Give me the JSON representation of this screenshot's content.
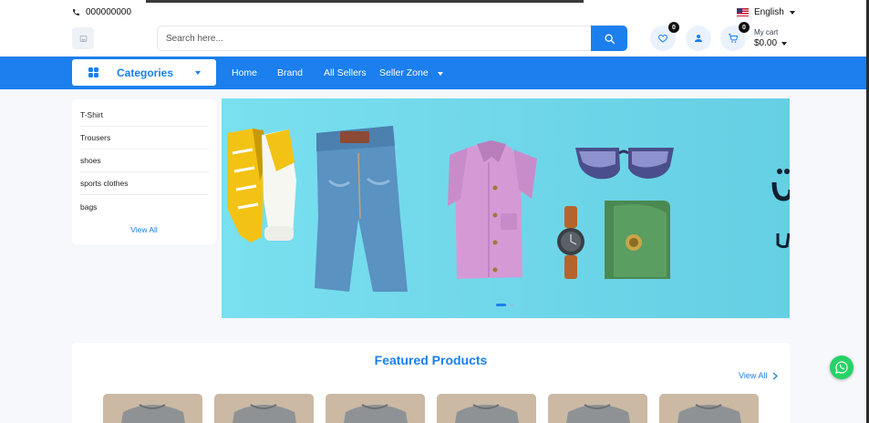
{
  "topbar": {
    "phone": "000000000",
    "language": "English"
  },
  "search": {
    "placeholder": "Search here..."
  },
  "header": {
    "wishlist_count": "0",
    "cart_count": "0",
    "cart_label": "My cart",
    "cart_total": "$0.00"
  },
  "nav": {
    "categories_label": "Categories",
    "links": [
      "Home",
      "Brand",
      "All Sellers",
      "Seller Zone"
    ]
  },
  "sidebar": {
    "items": [
      "T-Shirt",
      "Trousers",
      "shoes",
      "sports clothes",
      "bags"
    ],
    "view_all": "View All"
  },
  "featured": {
    "title": "Featured Products",
    "view_all": "View All"
  },
  "colors": {
    "primary": "#1b7fed",
    "banner_bg": "#6fd6e9",
    "whatsapp": "#25d366"
  },
  "icons": [
    "phone-icon",
    "flag-icon",
    "search-icon",
    "heart-icon",
    "user-icon",
    "cart-icon",
    "grid-icon",
    "whatsapp-icon"
  ]
}
